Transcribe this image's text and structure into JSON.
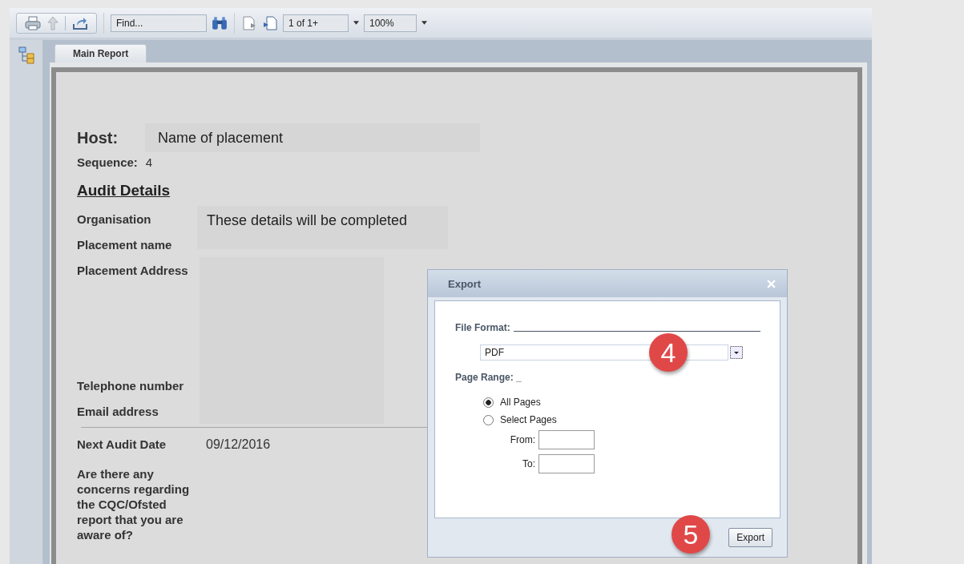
{
  "toolbar": {
    "find_placeholder": "Find...",
    "page_value": "1 of 1+",
    "zoom_value": "100%"
  },
  "tabs": [
    {
      "label": "Main Report",
      "selected": true
    }
  ],
  "report": {
    "host_label": "Host:",
    "host_value": "Name of placement",
    "sequence_label": "Sequence:",
    "sequence_value": "4",
    "section_title": "Audit Details",
    "organisation_label": "Organisation",
    "details_note": "These details will be completed",
    "placement_name_label": "Placement name",
    "address_label": "Placement Address",
    "telephone_label": "Telephone number",
    "email_label": "Email address",
    "next_audit_label": "Next Audit Date",
    "next_audit_value": "09/12/2016",
    "question": "Are there any concerns regarding the CQC/Ofsted report that you are aware of?"
  },
  "dialog": {
    "title": "Export",
    "file_format_label": "File Format:",
    "format_value": "PDF",
    "page_range_label": "Page Range: _",
    "radios": [
      {
        "label": "All Pages",
        "selected": true
      },
      {
        "label": "Select Pages",
        "selected": false
      }
    ],
    "from_label": "From:",
    "to_label": "To:",
    "export_button": "Export"
  },
  "callouts": [
    "4",
    "5"
  ]
}
